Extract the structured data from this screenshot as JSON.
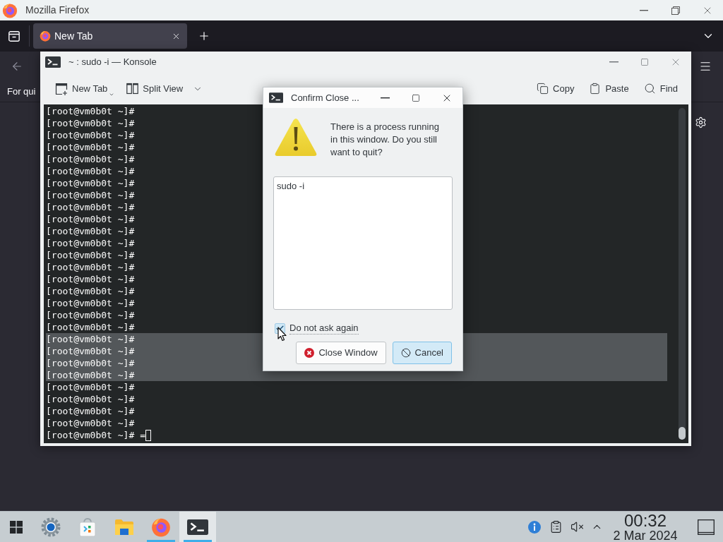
{
  "browser": {
    "title": "Mozilla Firefox",
    "tabs": [
      {
        "label": "New Tab",
        "selected": true
      }
    ],
    "bookmarks_text": "For qui"
  },
  "konsole": {
    "title": "~ : sudo -i — Konsole",
    "toolbar_left": [
      {
        "label": "New Tab",
        "kind": "new-tab"
      },
      {
        "label": "Split View",
        "kind": "split-view"
      }
    ],
    "toolbar_right": [
      {
        "label": "Copy",
        "kind": "copy"
      },
      {
        "label": "Paste",
        "kind": "paste"
      },
      {
        "label": "Find",
        "kind": "find"
      }
    ],
    "lines": [
      {
        "text": "[root@vm0b0t ~]#",
        "selected": false
      },
      {
        "text": "[root@vm0b0t ~]#",
        "selected": false
      },
      {
        "text": "[root@vm0b0t ~]#",
        "selected": false
      },
      {
        "text": "[root@vm0b0t ~]#",
        "selected": false
      },
      {
        "text": "[root@vm0b0t ~]#",
        "selected": false
      },
      {
        "text": "[root@vm0b0t ~]#",
        "selected": false
      },
      {
        "text": "[root@vm0b0t ~]#",
        "selected": false
      },
      {
        "text": "[root@vm0b0t ~]#",
        "selected": false
      },
      {
        "text": "[root@vm0b0t ~]#",
        "selected": false
      },
      {
        "text": "[root@vm0b0t ~]#",
        "selected": false
      },
      {
        "text": "[root@vm0b0t ~]#",
        "selected": false
      },
      {
        "text": "[root@vm0b0t ~]#",
        "selected": false
      },
      {
        "text": "[root@vm0b0t ~]#",
        "selected": false
      },
      {
        "text": "[root@vm0b0t ~]#",
        "selected": false
      },
      {
        "text": "[root@vm0b0t ~]#",
        "selected": false
      },
      {
        "text": "[root@vm0b0t ~]#",
        "selected": false
      },
      {
        "text": "[root@vm0b0t ~]#",
        "selected": false
      },
      {
        "text": "[root@vm0b0t ~]#",
        "selected": false
      },
      {
        "text": "[root@vm0b0t ~]#",
        "selected": false
      },
      {
        "text": "[root@vm0b0t ~]#",
        "selected": true
      },
      {
        "text": "[root@vm0b0t ~]#",
        "selected": true
      },
      {
        "text": "[root@vm0b0t ~]#",
        "selected": true
      },
      {
        "text": "[root@vm0b0t ~]#",
        "selected": true
      },
      {
        "text": "[root@vm0b0t ~]#",
        "selected": false
      },
      {
        "text": "[root@vm0b0t ~]#",
        "selected": false
      },
      {
        "text": "[root@vm0b0t ~]#",
        "selected": false
      },
      {
        "text": "[root@vm0b0t ~]#",
        "selected": false
      }
    ],
    "prompt": {
      "text": "[root@vm0b0t ~]#",
      "input": "="
    }
  },
  "dialog": {
    "title": "Confirm Close ...",
    "message": "There is a process running in this window. Do you still want to quit?",
    "processes": [
      "sudo -i"
    ],
    "checkbox": {
      "label": "Do not ask again",
      "checked": true
    },
    "buttons": [
      {
        "label": "Close Window",
        "kind": "close-window",
        "focused": false
      },
      {
        "label": "Cancel",
        "kind": "cancel",
        "focused": true
      }
    ]
  },
  "taskbar": {
    "apps": [
      {
        "kind": "settings",
        "running": false,
        "active": false
      },
      {
        "kind": "store",
        "running": false,
        "active": false
      },
      {
        "kind": "files",
        "running": false,
        "active": false
      },
      {
        "kind": "browser",
        "running": true,
        "active": false
      },
      {
        "kind": "terminal",
        "running": true,
        "active": true
      }
    ],
    "clock": {
      "time": "00:32",
      "date": "2 Mar 2024"
    }
  }
}
